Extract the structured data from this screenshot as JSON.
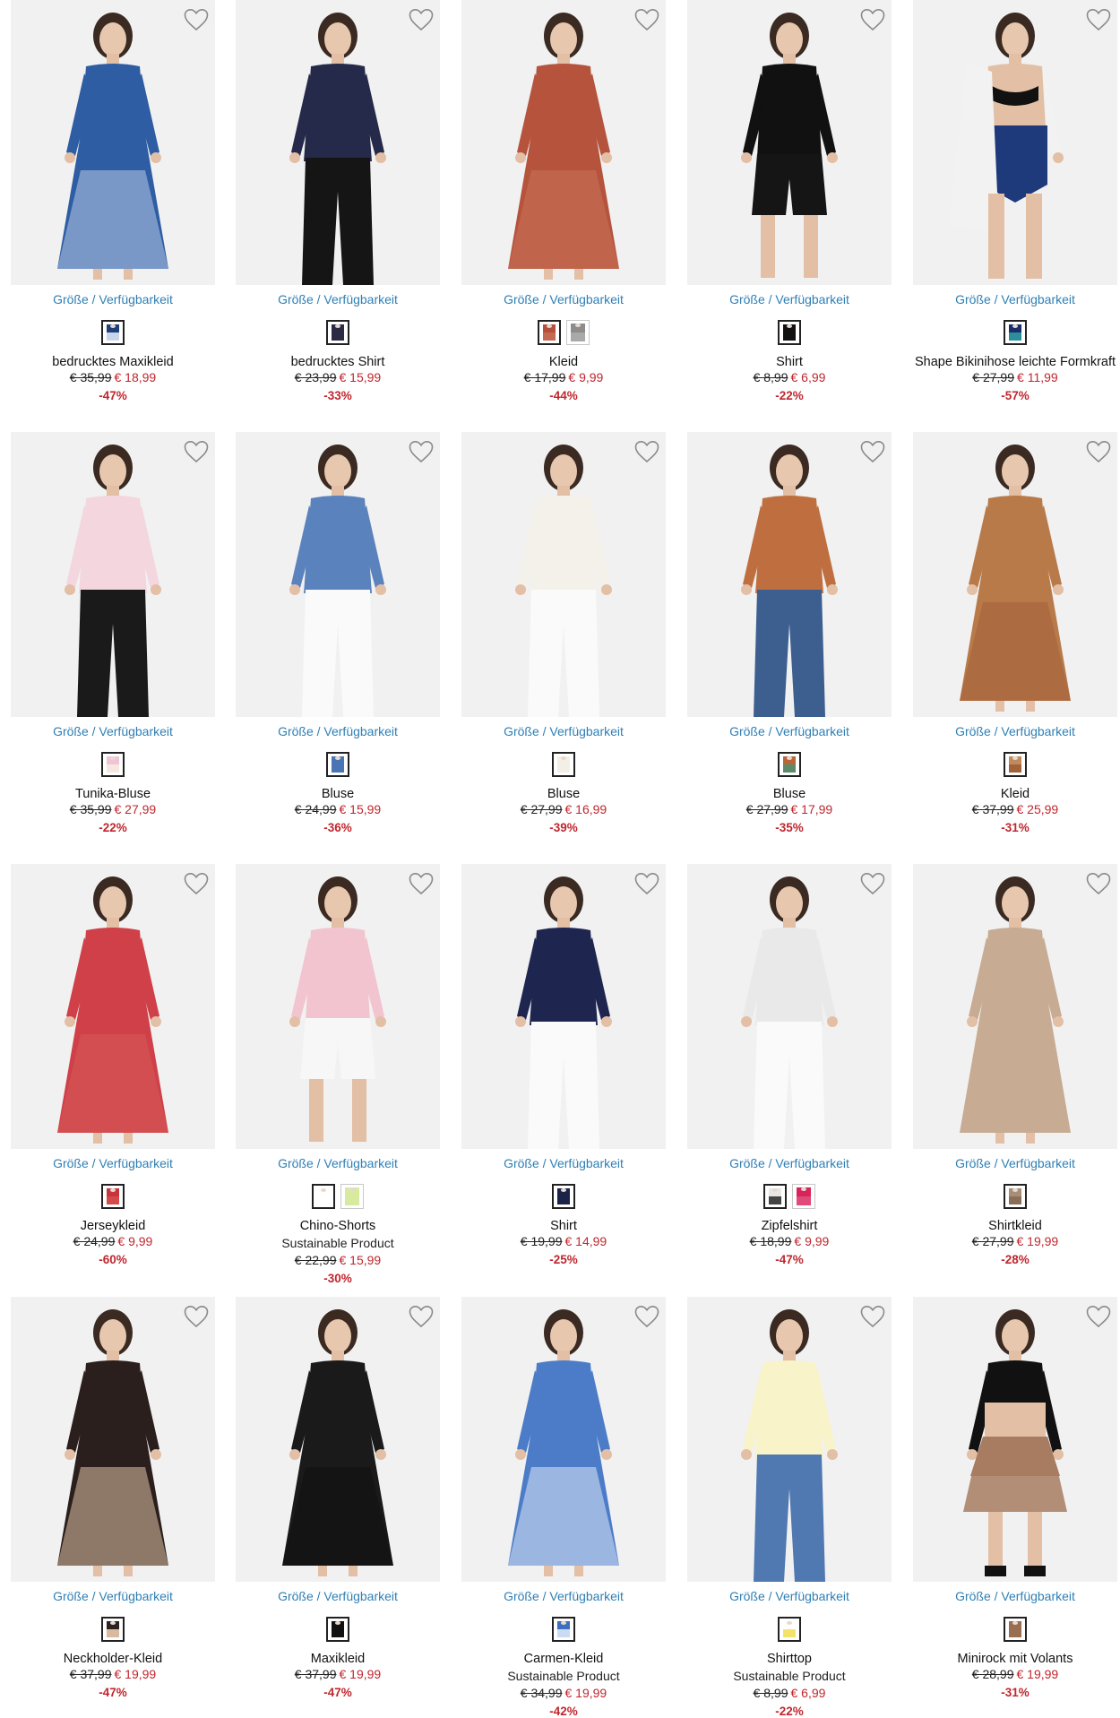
{
  "size_link_label": "Größe / Verfügbarkeit",
  "colors": {
    "link": "#2f7fb4",
    "sale_price": "#c0262d",
    "discount": "#c0262d",
    "photo_background": "#f1f1f1"
  },
  "products": [
    {
      "name": "bedrucktes Maxikleid",
      "subtitle": "",
      "old_price": "€ 35,99",
      "new_price": "€ 18,99",
      "discount": "-47%",
      "swatches": [
        {
          "top": "#1d3f7a",
          "bottom": "#c9d6ea"
        }
      ],
      "figure": {
        "top": "#2e5da3",
        "bottom": "#b8c8e6",
        "style": "dress"
      }
    },
    {
      "name": "bedrucktes Shirt",
      "subtitle": "",
      "old_price": "€ 23,99",
      "new_price": "€ 15,99",
      "discount": "-33%",
      "swatches": [
        {
          "top": "#2a2a45",
          "bottom": "#2a2a45"
        }
      ],
      "figure": {
        "top": "#262a4a",
        "bottom": "#151515",
        "style": "pants"
      }
    },
    {
      "name": "Kleid",
      "subtitle": "",
      "old_price": "€ 17,99",
      "new_price": "€ 9,99",
      "discount": "-44%",
      "swatches": [
        {
          "top": "#b4503c",
          "bottom": "#c46a52"
        },
        {
          "top": "#8c8c8c",
          "bottom": "#a9a9a9"
        }
      ],
      "figure": {
        "top": "#b5533d",
        "bottom": "#c8735a",
        "style": "dress"
      }
    },
    {
      "name": "Shirt",
      "subtitle": "",
      "old_price": "€ 8,99",
      "new_price": "€ 6,99",
      "discount": "-22%",
      "swatches": [
        {
          "top": "#111111",
          "bottom": "#111111"
        }
      ],
      "figure": {
        "top": "#111111",
        "bottom": "#151515",
        "style": "shorts"
      }
    },
    {
      "name": "Shape Bikinihose leichte Formkraft",
      "subtitle": "",
      "old_price": "€ 27,99",
      "new_price": "€ 11,99",
      "discount": "-57%",
      "swatches": [
        {
          "top": "#1a2d6b",
          "bottom": "#2a8f9a"
        }
      ],
      "figure": {
        "top": "#f2f2f2",
        "bottom": "#1e3a7a",
        "style": "bikini"
      }
    },
    {
      "name": "Tunika-Bluse",
      "subtitle": "",
      "old_price": "€ 35,99",
      "new_price": "€ 27,99",
      "discount": "-22%",
      "swatches": [
        {
          "top": "#f0c4d6",
          "bottom": "#f5e8e0"
        }
      ],
      "figure": {
        "top": "#f3d6de",
        "bottom": "#1a1a1a",
        "style": "pants"
      }
    },
    {
      "name": "Bluse",
      "subtitle": "",
      "old_price": "€ 24,99",
      "new_price": "€ 15,99",
      "discount": "-36%",
      "swatches": [
        {
          "top": "#4a74b4",
          "bottom": "#4a74b4"
        }
      ],
      "figure": {
        "top": "#5a82bd",
        "bottom": "#fafafa",
        "style": "pants"
      }
    },
    {
      "name": "Bluse",
      "subtitle": "",
      "old_price": "€ 27,99",
      "new_price": "€ 16,99",
      "discount": "-39%",
      "swatches": [
        {
          "top": "#f3efe6",
          "bottom": "#f3efe6"
        }
      ],
      "figure": {
        "top": "#f4f1ea",
        "bottom": "#fafafa",
        "style": "pants"
      }
    },
    {
      "name": "Bluse",
      "subtitle": "",
      "old_price": "€ 27,99",
      "new_price": "€ 17,99",
      "discount": "-35%",
      "swatches": [
        {
          "top": "#b9673a",
          "bottom": "#5c8a6a"
        }
      ],
      "figure": {
        "top": "#bf6f3f",
        "bottom": "#3d5f8f",
        "style": "pants"
      }
    },
    {
      "name": "Kleid",
      "subtitle": "",
      "old_price": "€ 37,99",
      "new_price": "€ 25,99",
      "discount": "-31%",
      "swatches": [
        {
          "top": "#c08a5c",
          "bottom": "#a2623a"
        }
      ],
      "figure": {
        "top": "#b97a4a",
        "bottom": "#a35f38",
        "style": "dress"
      }
    },
    {
      "name": "Jerseykleid",
      "subtitle": "",
      "old_price": "€ 24,99",
      "new_price": "€ 9,99",
      "discount": "-60%",
      "swatches": [
        {
          "top": "#c8343c",
          "bottom": "#d24a4a"
        }
      ],
      "figure": {
        "top": "#cf4048",
        "bottom": "#d65a5a",
        "style": "dress"
      }
    },
    {
      "name": "Chino-Shorts",
      "subtitle": "Sustainable Product",
      "old_price": "€ 22,99",
      "new_price": "€ 15,99",
      "discount": "-30%",
      "swatches": [
        {
          "top": "#ffffff",
          "bottom": "#ffffff"
        },
        {
          "top": "#d8eaa0",
          "bottom": "#d8eaa0"
        }
      ],
      "figure": {
        "top": "#f2c4cf",
        "bottom": "#f7f7f7",
        "style": "shorts"
      }
    },
    {
      "name": "Shirt",
      "subtitle": "",
      "old_price": "€ 19,99",
      "new_price": "€ 14,99",
      "discount": "-25%",
      "swatches": [
        {
          "top": "#1c2348",
          "bottom": "#1c2348"
        }
      ],
      "figure": {
        "top": "#1e2650",
        "bottom": "#fafafa",
        "style": "pants"
      }
    },
    {
      "name": "Zipfelshirt",
      "subtitle": "",
      "old_price": "€ 18,99",
      "new_price": "€ 9,99",
      "discount": "-47%",
      "swatches": [
        {
          "top": "#e6e6e6",
          "bottom": "#444444"
        },
        {
          "top": "#d8245a",
          "bottom": "#e04a78"
        }
      ],
      "figure": {
        "top": "#e9e9e9",
        "bottom": "#fafafa",
        "style": "pants"
      }
    },
    {
      "name": "Shirtkleid",
      "subtitle": "",
      "old_price": "€ 27,99",
      "new_price": "€ 19,99",
      "discount": "-28%",
      "swatches": [
        {
          "top": "#a88e78",
          "bottom": "#8a6e58"
        }
      ],
      "figure": {
        "top": "#c7ab92",
        "bottom": "#c7ab92",
        "style": "dress"
      }
    },
    {
      "name": "Neckholder-Kleid",
      "subtitle": "",
      "old_price": "€ 37,99",
      "new_price": "€ 19,99",
      "discount": "-47%",
      "swatches": [
        {
          "top": "#2b2220",
          "bottom": "#d9b9a0"
        }
      ],
      "figure": {
        "top": "#2a1f1c",
        "bottom": "#e0c2aa",
        "style": "dress"
      }
    },
    {
      "name": "Maxikleid",
      "subtitle": "",
      "old_price": "€ 37,99",
      "new_price": "€ 19,99",
      "discount": "-47%",
      "swatches": [
        {
          "top": "#111111",
          "bottom": "#111111"
        }
      ],
      "figure": {
        "top": "#1a1a1a",
        "bottom": "#111111",
        "style": "dress"
      }
    },
    {
      "name": "Carmen-Kleid",
      "subtitle": "Sustainable Product",
      "old_price": "€ 34,99",
      "new_price": "€ 19,99",
      "discount": "-42%",
      "swatches": [
        {
          "top": "#3d6fc0",
          "bottom": "#c9daf2"
        }
      ],
      "figure": {
        "top": "#4c7cc8",
        "bottom": "#dbe6f6",
        "style": "dress"
      }
    },
    {
      "name": "Shirttop",
      "subtitle": "Sustainable Product",
      "old_price": "€ 8,99",
      "new_price": "€ 6,99",
      "discount": "-22%",
      "swatches": [
        {
          "top": "#ffffff",
          "bottom": "#f4e36a"
        }
      ],
      "figure": {
        "top": "#f8f3c8",
        "bottom": "#4f79b0",
        "style": "pants"
      }
    },
    {
      "name": "Minirock mit Volants",
      "subtitle": "",
      "old_price": "€ 28,99",
      "new_price": "€ 19,99",
      "discount": "-31%",
      "swatches": [
        {
          "top": "#9a6e52",
          "bottom": "#9a6e52"
        }
      ],
      "figure": {
        "top": "#111111",
        "bottom": "#a87c60",
        "style": "skirt"
      }
    }
  ]
}
